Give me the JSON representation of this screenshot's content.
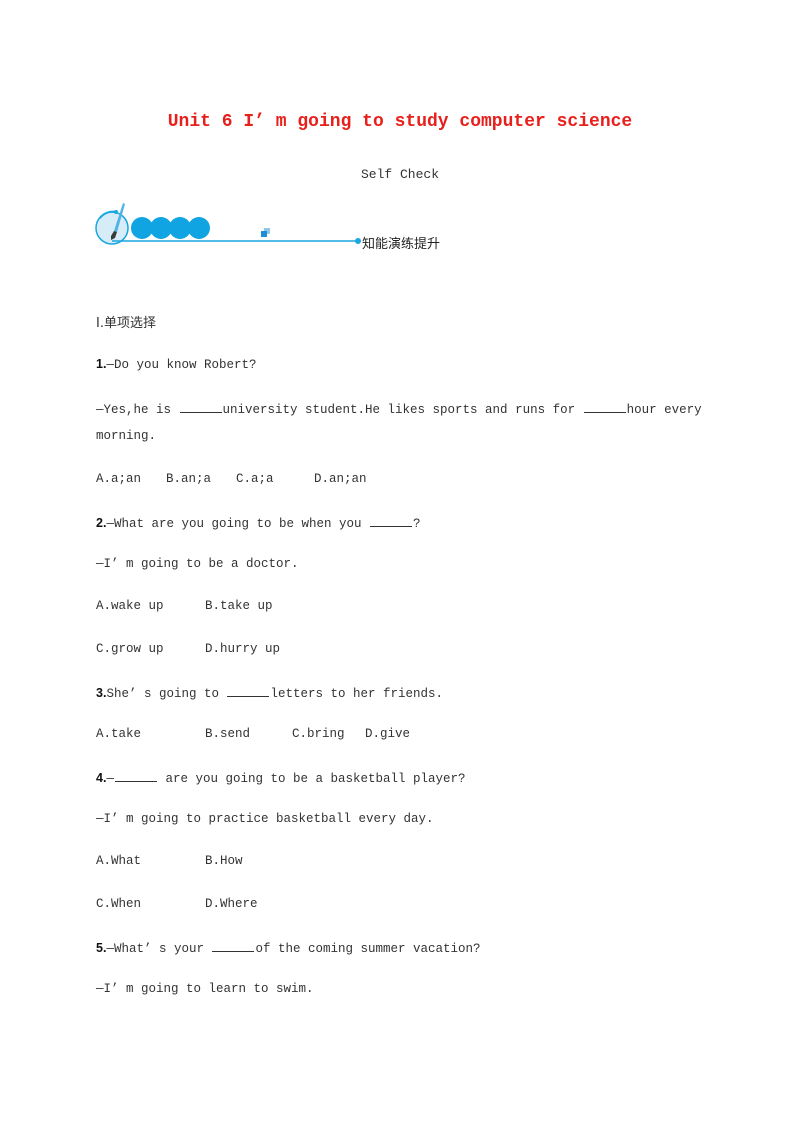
{
  "header": {
    "title": "Unit 6 I’ m going to study computer science",
    "subtitle": "Self Check",
    "banner_label": "知能演练提升",
    "title_color": "#e8201c",
    "accent_color": "#1aa7e0"
  },
  "section": {
    "label": "Ⅰ.单项选择"
  },
  "questions": [
    {
      "number": "1.",
      "prompt_pre": "—Do you know Robert?",
      "reply_pre": "—Yes,he is ",
      "reply_mid": "university student.He likes sports and runs for ",
      "reply_post": "hour every",
      "reply_cont": "morning.",
      "options": [
        "A.a;an",
        "B.an;a",
        "C.a;a",
        "D.an;an"
      ]
    },
    {
      "number": "2.",
      "prompt_pre": "—What are you going to be when you ",
      "prompt_post": "?",
      "reply": "—I’ m going to be a doctor.",
      "options": [
        "A.wake up",
        "B.take up",
        "C.grow up",
        "D.hurry up"
      ]
    },
    {
      "number": "3.",
      "prompt_pre": "She’ s going to ",
      "prompt_post": "letters to her friends.",
      "options": [
        "A.take",
        "B.send",
        "C.bring",
        "D.give"
      ]
    },
    {
      "number": "4.",
      "prompt_pre": "—",
      "prompt_post": " are you going to be a basketball player?",
      "reply": "—I’ m going to practice basketball every day.",
      "options": [
        "A.What",
        "B.How",
        "C.When",
        "D.Where"
      ]
    },
    {
      "number": "5.",
      "prompt_pre": "—What’ s your ",
      "prompt_post": "of the coming summer vacation?",
      "reply": "—I’ m going to learn to swim."
    }
  ]
}
